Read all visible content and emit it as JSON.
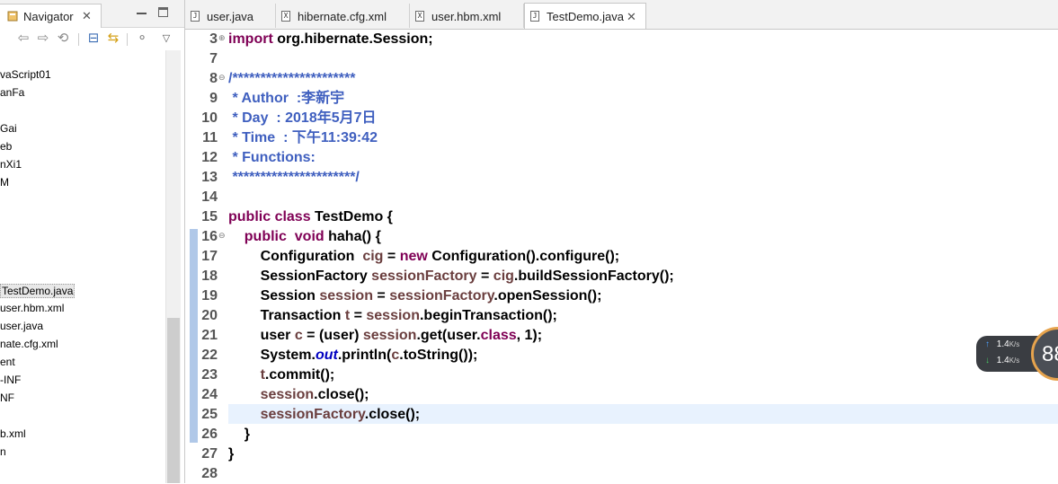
{
  "navigator": {
    "title": "Navigator",
    "close": "✕",
    "tree": [
      {
        "label": "vaScript01"
      },
      {
        "label": "anFa"
      },
      {
        "label": "Gai"
      },
      {
        "label": "eb"
      },
      {
        "label": "nXi1"
      },
      {
        "label": "M"
      },
      {
        "label": "TestDemo.java",
        "selected": true
      },
      {
        "label": "user.hbm.xml"
      },
      {
        "label": "user.java"
      },
      {
        "label": "nate.cfg.xml"
      },
      {
        "label": "ent"
      },
      {
        "label": "-INF"
      },
      {
        "label": "NF"
      },
      {
        "label": "b.xml"
      },
      {
        "label": "n"
      }
    ],
    "toolbar_icons": [
      "back-arrow-icon",
      "forward-arrow-icon",
      "up-icon",
      "collapse-all-icon",
      "link-with-editor-icon",
      "filter-icon",
      "view-menu-icon"
    ]
  },
  "editor": {
    "tabs": [
      {
        "label": "user.java",
        "icon": "J",
        "active": false
      },
      {
        "label": "hibernate.cfg.xml",
        "icon": "X",
        "active": false
      },
      {
        "label": "user.hbm.xml",
        "icon": "X",
        "active": false
      },
      {
        "label": "TestDemo.java",
        "icon": "J",
        "active": true,
        "close": "✕"
      }
    ],
    "lines": [
      {
        "n": "3",
        "fold": "⊕",
        "tokens": [
          {
            "t": "import",
            "c": "kw"
          },
          {
            "t": " org.hibernate.Session;"
          }
        ]
      },
      {
        "n": "7",
        "tokens": []
      },
      {
        "n": "8",
        "fold": "⊖",
        "tokens": [
          {
            "t": "/**********************",
            "c": "cm"
          }
        ]
      },
      {
        "n": "9",
        "tokens": [
          {
            "t": " * Author  :李新宇",
            "c": "cm"
          }
        ]
      },
      {
        "n": "10",
        "tokens": [
          {
            "t": " * Day  : 2018年5月7日",
            "c": "cm"
          }
        ]
      },
      {
        "n": "11",
        "tokens": [
          {
            "t": " * Time  : 下午11:39:42",
            "c": "cm"
          }
        ]
      },
      {
        "n": "12",
        "tokens": [
          {
            "t": " * Functions:",
            "c": "cm"
          }
        ]
      },
      {
        "n": "13",
        "tokens": [
          {
            "t": " **********************/",
            "c": "cm"
          }
        ]
      },
      {
        "n": "14",
        "tokens": []
      },
      {
        "n": "15",
        "tokens": [
          {
            "t": "public",
            "c": "kw"
          },
          {
            "t": " "
          },
          {
            "t": "class",
            "c": "kw"
          },
          {
            "t": " TestDemo {"
          }
        ]
      },
      {
        "n": "16",
        "fold": "⊖",
        "tokens": [
          {
            "t": "    "
          },
          {
            "t": "public",
            "c": "kw"
          },
          {
            "t": "  "
          },
          {
            "t": "void",
            "c": "kw"
          },
          {
            "t": " haha() {"
          }
        ]
      },
      {
        "n": "17",
        "tokens": [
          {
            "t": "        Configuration  "
          },
          {
            "t": "cig",
            "c": "var"
          },
          {
            "t": " = "
          },
          {
            "t": "new",
            "c": "kw"
          },
          {
            "t": " Configuration().configure();"
          }
        ]
      },
      {
        "n": "18",
        "tokens": [
          {
            "t": "        SessionFactory "
          },
          {
            "t": "sessionFactory",
            "c": "var"
          },
          {
            "t": " = "
          },
          {
            "t": "cig",
            "c": "var"
          },
          {
            "t": ".buildSessionFactory();"
          }
        ]
      },
      {
        "n": "19",
        "tokens": [
          {
            "t": "        Session "
          },
          {
            "t": "session",
            "c": "var"
          },
          {
            "t": " = "
          },
          {
            "t": "sessionFactory",
            "c": "var"
          },
          {
            "t": ".openSession();"
          }
        ]
      },
      {
        "n": "20",
        "tokens": [
          {
            "t": "        Transaction "
          },
          {
            "t": "t",
            "c": "var"
          },
          {
            "t": " = "
          },
          {
            "t": "session",
            "c": "var"
          },
          {
            "t": ".beginTransaction();"
          }
        ]
      },
      {
        "n": "21",
        "tokens": [
          {
            "t": "        user "
          },
          {
            "t": "c",
            "c": "var"
          },
          {
            "t": " = (user) "
          },
          {
            "t": "session",
            "c": "var"
          },
          {
            "t": ".get(user."
          },
          {
            "t": "class",
            "c": "kw"
          },
          {
            "t": ", 1);"
          }
        ]
      },
      {
        "n": "22",
        "tokens": [
          {
            "t": "        System."
          },
          {
            "t": "out",
            "c": "fld"
          },
          {
            "t": ".println("
          },
          {
            "t": "c",
            "c": "var"
          },
          {
            "t": ".toString());"
          }
        ]
      },
      {
        "n": "23",
        "tokens": [
          {
            "t": "        "
          },
          {
            "t": "t",
            "c": "var"
          },
          {
            "t": ".commit();"
          }
        ]
      },
      {
        "n": "24",
        "tokens": [
          {
            "t": "        "
          },
          {
            "t": "session",
            "c": "var"
          },
          {
            "t": ".close();"
          }
        ]
      },
      {
        "n": "25",
        "tokens": [
          {
            "t": "        "
          },
          {
            "t": "sessionFactory",
            "c": "var"
          },
          {
            "t": ".close();"
          }
        ]
      },
      {
        "n": "26",
        "tokens": [
          {
            "t": "    }"
          }
        ]
      },
      {
        "n": "27",
        "tokens": [
          {
            "t": "}"
          }
        ]
      },
      {
        "n": "28",
        "tokens": []
      }
    ]
  },
  "netspeed": {
    "up": "1.4",
    "down": "1.4",
    "unit": "K/s",
    "percent": "88"
  }
}
